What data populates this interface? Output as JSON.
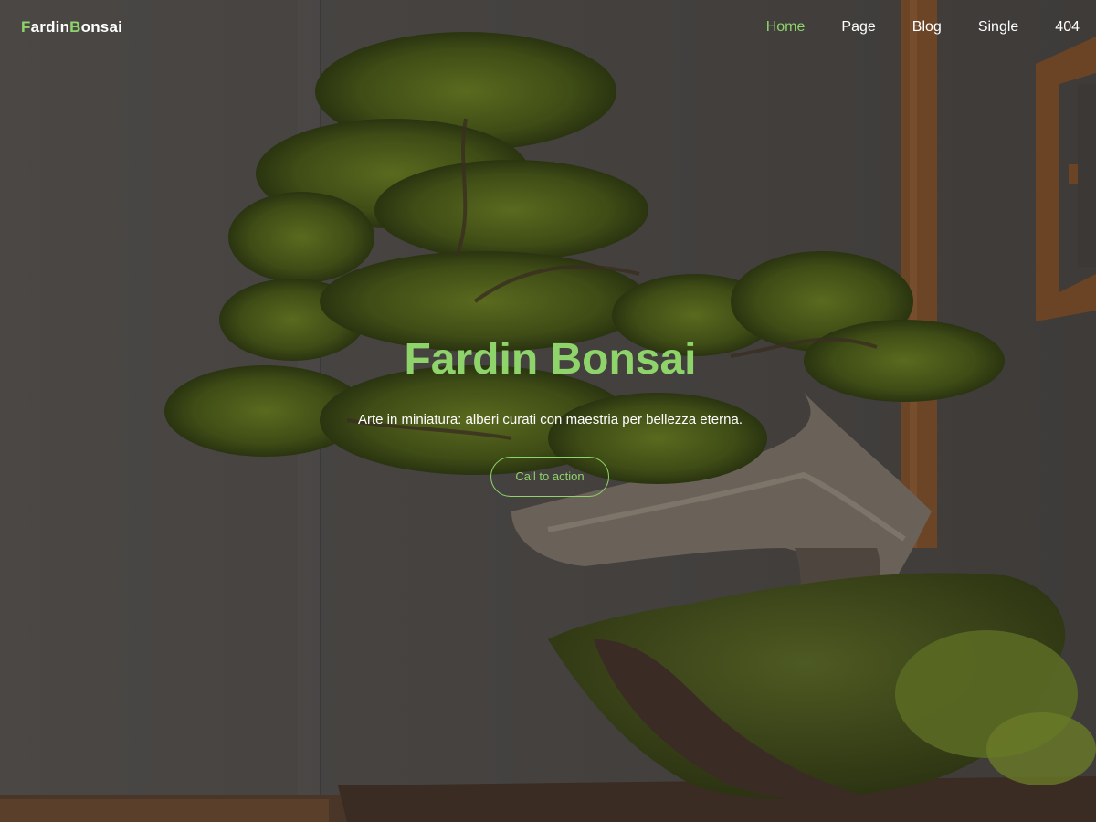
{
  "header": {
    "logo_first_letter": "F",
    "logo_first_rest": "ardin",
    "logo_second_letter": "B",
    "logo_second_rest": "onsai",
    "nav": [
      {
        "label": "Home",
        "active": true
      },
      {
        "label": "Page",
        "active": false
      },
      {
        "label": "Blog",
        "active": false
      },
      {
        "label": "Single",
        "active": false
      },
      {
        "label": "404",
        "active": false
      }
    ]
  },
  "hero": {
    "title": "Fardin Bonsai",
    "subtitle": "Arte in miniatura: alberi curati con maestria per bellezza eterna.",
    "cta_label": "Call to action",
    "background_image": "bonsai-tree-photo"
  },
  "colors": {
    "accent": "#8ed46a",
    "text": "#ffffff",
    "overlay": "#000000"
  }
}
